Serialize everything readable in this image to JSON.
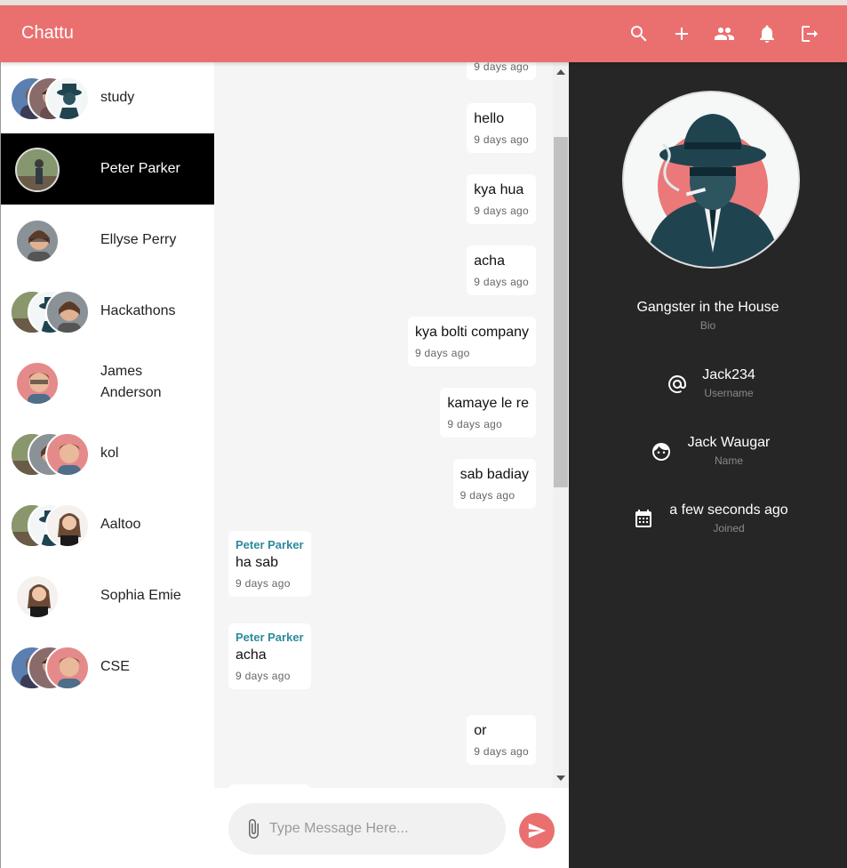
{
  "app": {
    "title": "Chattu",
    "accent_color": "#ea7070",
    "header_icons": [
      "search-icon",
      "add-icon",
      "group-icon",
      "notification-icon",
      "logout-icon"
    ]
  },
  "sidebar": {
    "chats": [
      {
        "name": "study",
        "avatar_count": 3,
        "active": false
      },
      {
        "name": "Peter Parker",
        "avatar_count": 1,
        "active": true
      },
      {
        "name": "Ellyse Perry",
        "avatar_count": 1,
        "active": false
      },
      {
        "name": "Hackathons",
        "avatar_count": 3,
        "active": false
      },
      {
        "name": "James Anderson",
        "avatar_count": 1,
        "active": false
      },
      {
        "name": "kol",
        "avatar_count": 3,
        "active": false
      },
      {
        "name": "Aaltoo",
        "avatar_count": 3,
        "active": false
      },
      {
        "name": "Sophia Emie",
        "avatar_count": 1,
        "active": false
      },
      {
        "name": "CSE",
        "avatar_count": 3,
        "active": false
      }
    ]
  },
  "messages": [
    {
      "text": "",
      "time": "9 days ago",
      "mine": true
    },
    {
      "text": "hello",
      "time": "9 days ago",
      "mine": true
    },
    {
      "text": "kya hua",
      "time": "9 days ago",
      "mine": true
    },
    {
      "text": "acha",
      "time": "9 days ago",
      "mine": true
    },
    {
      "text": "kya bolti company",
      "time": "9 days ago",
      "mine": true
    },
    {
      "text": "kamaye le re",
      "time": "9 days ago",
      "mine": true
    },
    {
      "text": "sab badiay",
      "time": "9 days ago",
      "mine": true
    },
    {
      "sender": "Peter Parker",
      "text": "ha sab",
      "time": "9 days ago",
      "mine": false
    },
    {
      "sender": "Peter Parker",
      "text": "acha",
      "time": "9 days ago",
      "mine": false
    },
    {
      "text": "or",
      "time": "9 days ago",
      "mine": true
    }
  ],
  "composer": {
    "placeholder": "Type Message Here...",
    "value": ""
  },
  "profile": {
    "bio": "Gangster in the House",
    "bio_label": "Bio",
    "username": "Jack234",
    "username_label": "Username",
    "name": "Jack Waugar",
    "name_label": "Name",
    "joined": "a few seconds ago",
    "joined_label": "Joined"
  }
}
